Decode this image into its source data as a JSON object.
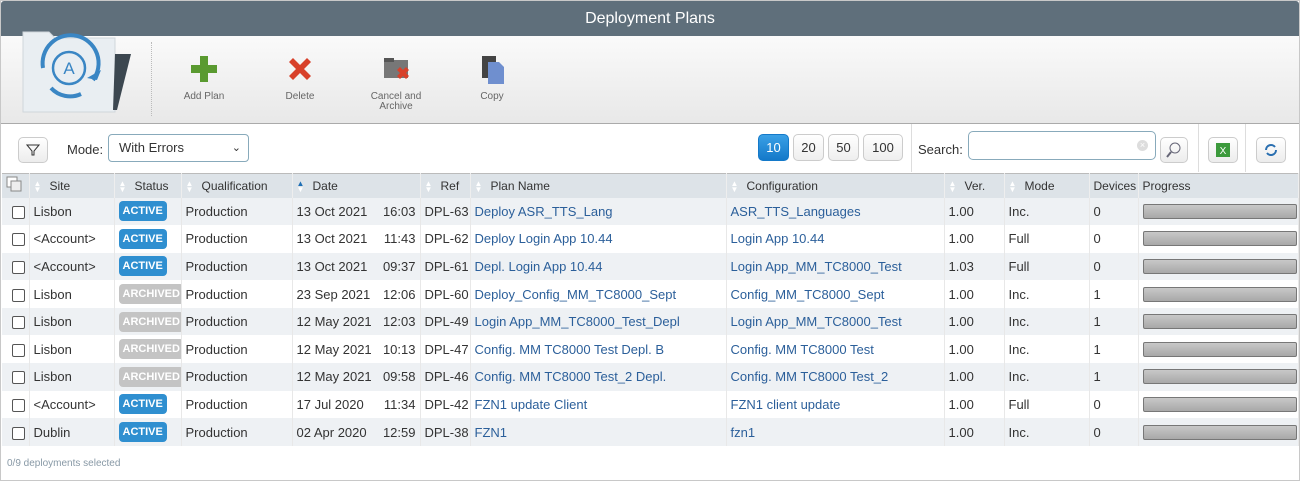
{
  "title": "Deployment Plans",
  "toolbar": {
    "add": "Add Plan",
    "delete": "Delete",
    "cancel_archive": "Cancel and Archive",
    "copy": "Copy"
  },
  "filter": {
    "mode_label": "Mode:",
    "mode_value": "With Errors",
    "page_sizes": [
      "10",
      "20",
      "50",
      "100"
    ],
    "page_size_selected": "10",
    "search_label": "Search:",
    "search_value": ""
  },
  "columns": [
    "Site",
    "Status",
    "Qualification",
    "Date",
    "Ref",
    "Plan Name",
    "Configuration",
    "Ver.",
    "Mode",
    "Devices",
    "Progress"
  ],
  "sort": {
    "column": "Date",
    "direction": "desc"
  },
  "colors": {
    "active": "#2f8fd0",
    "archived": "#c4c4c4",
    "link": "#2b5f9a",
    "header": "#5f6f7b"
  },
  "rows": [
    {
      "site": "Lisbon",
      "status": "ACTIVE",
      "qual": "Production",
      "date": "13 Oct 2021",
      "time": "16:03",
      "ref": "DPL-63",
      "plan": "Deploy ASR_TTS_Lang",
      "config": "ASR_TTS_Languages",
      "ver": "1.00",
      "mode": "Inc.",
      "devices": "0",
      "progress": 0
    },
    {
      "site": "<Account>",
      "status": "ACTIVE",
      "qual": "Production",
      "date": "13 Oct 2021",
      "time": "11:43",
      "ref": "DPL-62",
      "plan": "Deploy Login App 10.44",
      "config": "Login App 10.44",
      "ver": "1.00",
      "mode": "Full",
      "devices": "0",
      "progress": 0
    },
    {
      "site": "<Account>",
      "status": "ACTIVE",
      "qual": "Production",
      "date": "13 Oct 2021",
      "time": "09:37",
      "ref": "DPL-61",
      "plan": "Depl. Login App 10.44",
      "config": "Login App_MM_TC8000_Test",
      "ver": "1.03",
      "mode": "Full",
      "devices": "0",
      "progress": 0
    },
    {
      "site": "Lisbon",
      "status": "ARCHIVED",
      "qual": "Production",
      "date": "23 Sep 2021",
      "time": "12:06",
      "ref": "DPL-60",
      "plan": "Deploy_Config_MM_TC8000_Sept",
      "config": "Config_MM_TC8000_Sept",
      "ver": "1.00",
      "mode": "Inc.",
      "devices": "1",
      "progress": 0
    },
    {
      "site": "Lisbon",
      "status": "ARCHIVED",
      "qual": "Production",
      "date": "12 May 2021",
      "time": "12:03",
      "ref": "DPL-49",
      "plan": "Login App_MM_TC8000_Test_Depl",
      "config": "Login App_MM_TC8000_Test",
      "ver": "1.00",
      "mode": "Inc.",
      "devices": "1",
      "progress": 0
    },
    {
      "site": "Lisbon",
      "status": "ARCHIVED",
      "qual": "Production",
      "date": "12 May 2021",
      "time": "10:13",
      "ref": "DPL-47",
      "plan": "Config. MM TC8000 Test Depl. B",
      "config": "Config. MM TC8000 Test",
      "ver": "1.00",
      "mode": "Inc.",
      "devices": "1",
      "progress": 0
    },
    {
      "site": "Lisbon",
      "status": "ARCHIVED",
      "qual": "Production",
      "date": "12 May 2021",
      "time": "09:58",
      "ref": "DPL-46",
      "plan": "Config. MM TC8000 Test_2 Depl.",
      "config": "Config. MM TC8000 Test_2",
      "ver": "1.00",
      "mode": "Inc.",
      "devices": "1",
      "progress": 0
    },
    {
      "site": "<Account>",
      "status": "ACTIVE",
      "qual": "Production",
      "date": "17 Jul 2020",
      "time": "11:34",
      "ref": "DPL-42",
      "plan": "FZN1 update Client",
      "config": "FZN1 client update",
      "ver": "1.00",
      "mode": "Full",
      "devices": "0",
      "progress": 0
    },
    {
      "site": "Dublin",
      "status": "ACTIVE",
      "qual": "Production",
      "date": "02 Apr 2020",
      "time": "12:59",
      "ref": "DPL-38",
      "plan": "FZN1",
      "config": "fzn1",
      "ver": "1.00",
      "mode": "Inc.",
      "devices": "0",
      "progress": 0
    }
  ],
  "footer": "0/9 deployments selected"
}
